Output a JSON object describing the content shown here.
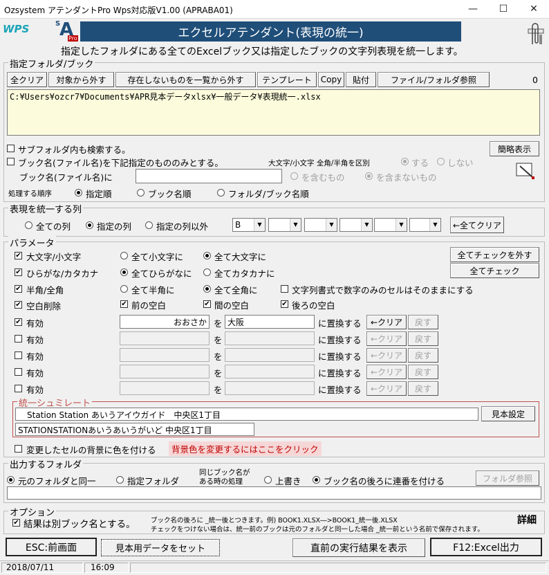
{
  "window": {
    "title": "Ozsystem アテンダントPro Wps対応版V1.00 (APRABA01)",
    "minimize": "—",
    "maximize": "☐",
    "close": "✕"
  },
  "logo": {
    "wps": "WPS",
    "sa_s": "S",
    "sa_a": "A",
    "sa_pro": "Pro"
  },
  "banner": {
    "title": "エクセルアテンダント(表現の統一)"
  },
  "description": "指定したフォルダにある全てのExcelブック又は指定したブックの文字列表現を統一します。",
  "folder_section": {
    "title": "指定フォルダ/ブック",
    "buttons": [
      "全クリア",
      "対象から外す",
      "存在しないものを一覧から外す",
      "テンプレート",
      "Copy",
      "貼付",
      "ファイル/フォルダ参照"
    ],
    "count": "0",
    "path": "C:¥Users¥ozcr7¥Documents¥APR見本データxlsx¥一般データ¥表現統一.xlsx",
    "search_subfolders": "サブフォルダ内も検索する。",
    "book_name_only": "ブック名(ファイル名)を下記指定のもののみとする。",
    "case_width_label": "大文字/小文字 全角/半角を区別",
    "yes": "する",
    "no": "しない",
    "book_name_label": "ブック名(ファイル名)に",
    "contains": "を含むもの",
    "not_contains": "を含まないもの",
    "order_label": "処理する順序",
    "order_options": [
      "指定順",
      "ブック名順",
      "フォルダ/ブック名順"
    ],
    "simple_view": "簡略表示"
  },
  "columns_section": {
    "title": "表現を統一する列",
    "options": [
      "全ての列",
      "指定の列",
      "指定の列以外"
    ],
    "col1": "B",
    "clear_all": "←全てクリア"
  },
  "params_section": {
    "title": "パラメータ",
    "case": {
      "label": "大文字/小文字",
      "opt1": "全て小文字に",
      "opt2": "全て大文字に"
    },
    "kana": {
      "label": "ひらがな/カタカナ",
      "opt1": "全てひらがなに",
      "opt2": "全てカタカナに"
    },
    "width": {
      "label": "半角/全角",
      "opt1": "全て半角に",
      "opt2": "全て全角に",
      "extra": "文字列書式で数字のみのセルはそのままにする"
    },
    "space": {
      "label": "空白削除",
      "front": "前の空白",
      "middle": "間の空白",
      "back": "後ろの空白"
    },
    "uncheck_all": "全てチェックを外す",
    "check_all": "全てチェック",
    "replace_rows": [
      {
        "label": "有効",
        "from": "おおさか",
        "wo": "を",
        "to": "大阪",
        "replace": "に置換する",
        "clear": "←クリア",
        "undo": "戻す"
      },
      {
        "label": "有効",
        "from": "",
        "wo": "を",
        "to": "",
        "replace": "に置換する",
        "clear": "←クリア",
        "undo": "戻す"
      },
      {
        "label": "有効",
        "from": "",
        "wo": "を",
        "to": "",
        "replace": "に置換する",
        "clear": "←クリア",
        "undo": "戻す"
      },
      {
        "label": "有効",
        "from": "",
        "wo": "を",
        "to": "",
        "replace": "に置換する",
        "clear": "←クリア",
        "undo": "戻す"
      },
      {
        "label": "有効",
        "from": "",
        "wo": "を",
        "to": "",
        "replace": "に置換する",
        "clear": "←クリア",
        "undo": "戻す"
      }
    ],
    "simulate_title": "統一シュミレート",
    "sim_before": "Station Station あいうアイウガイド　中央区1丁目",
    "sim_after": "STATIONSTATIONあいうあいうがいど 中央区1丁目",
    "sample_settings": "見本設定",
    "color_changed": "変更したセルの背景に色を付ける",
    "color_link": "背景色を変更するにはここをクリック"
  },
  "output_section": {
    "title": "出力するフォルダ",
    "same_folder": "元のフォルダと同一",
    "specified_folder": "指定フォルダ",
    "same_name_line1": "同じブック名が",
    "same_name_line2": "ある時の処理",
    "overwrite": "上書き",
    "append_number": "ブック名の後ろに連番を付ける",
    "folder_browse": "フォルダ参照",
    "path": ""
  },
  "options_section": {
    "title": "オプション",
    "separate_book": "結果は別ブック名とする。",
    "note1": "ブック名の後ろに _統一後とつきます。例) BOOK1.XLSX―>BOOK1_統一後.XLSX",
    "note2": "チェックをつけない場合は、統一前のブックは元のフォルダと同一した場合 _統一前という名前で保存されます。",
    "detail": "詳細"
  },
  "footer": {
    "esc": "ESC:前画面",
    "sample_data": "見本用データをセット",
    "show_last": "直前の実行結果を表示",
    "f12": "F12:Excel出力"
  },
  "status": {
    "date": "2018/07/11",
    "time": "16:09"
  },
  "colors": {
    "banner": "#1f4e79",
    "note_bg": "#fcfbdc",
    "link_bg": "#f6d7d7",
    "link_fg": "#c00000",
    "sim_border": "#c0504d"
  }
}
